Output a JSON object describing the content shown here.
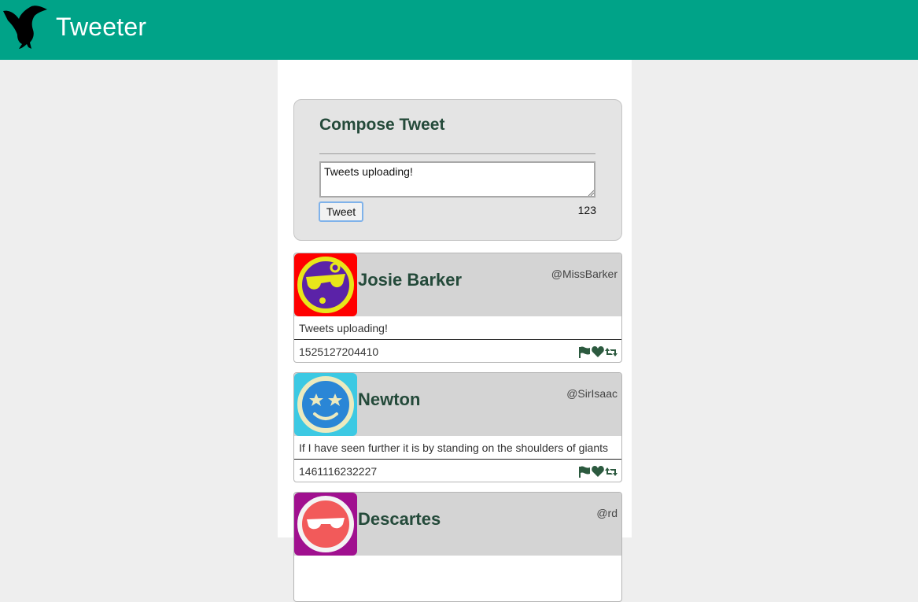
{
  "header": {
    "app_title": "Tweeter",
    "logo_icon": "hummingbird-icon",
    "background": "#00a388"
  },
  "compose": {
    "title": "Compose Tweet",
    "text_value": "Tweets uploading!",
    "button_label": "Tweet",
    "char_counter": "123"
  },
  "tweets": [
    {
      "name": "Josie Barker",
      "handle": "@MissBarker",
      "text": "Tweets uploading!",
      "timestamp": "1525127204410",
      "avatar_bg": "#ff0000",
      "avatar_icon": "cool-face-avatar"
    },
    {
      "name": "Newton",
      "handle": "@SirIsaac",
      "text": "If I have seen further it is by standing on the shoulders of giants",
      "timestamp": "1461116232227",
      "avatar_bg": "#3cc9e3",
      "avatar_icon": "star-eyes-avatar"
    },
    {
      "name": "Descartes",
      "handle": "@rd",
      "text": "",
      "timestamp": "",
      "avatar_bg": "#a0108f",
      "avatar_icon": "sunglasses-avatar"
    }
  ],
  "actions": [
    "flag-icon",
    "heart-icon",
    "retweet-icon"
  ],
  "colors": {
    "accent": "#00a388",
    "name_text": "#244a3a",
    "page_bg": "#eeeeee"
  }
}
